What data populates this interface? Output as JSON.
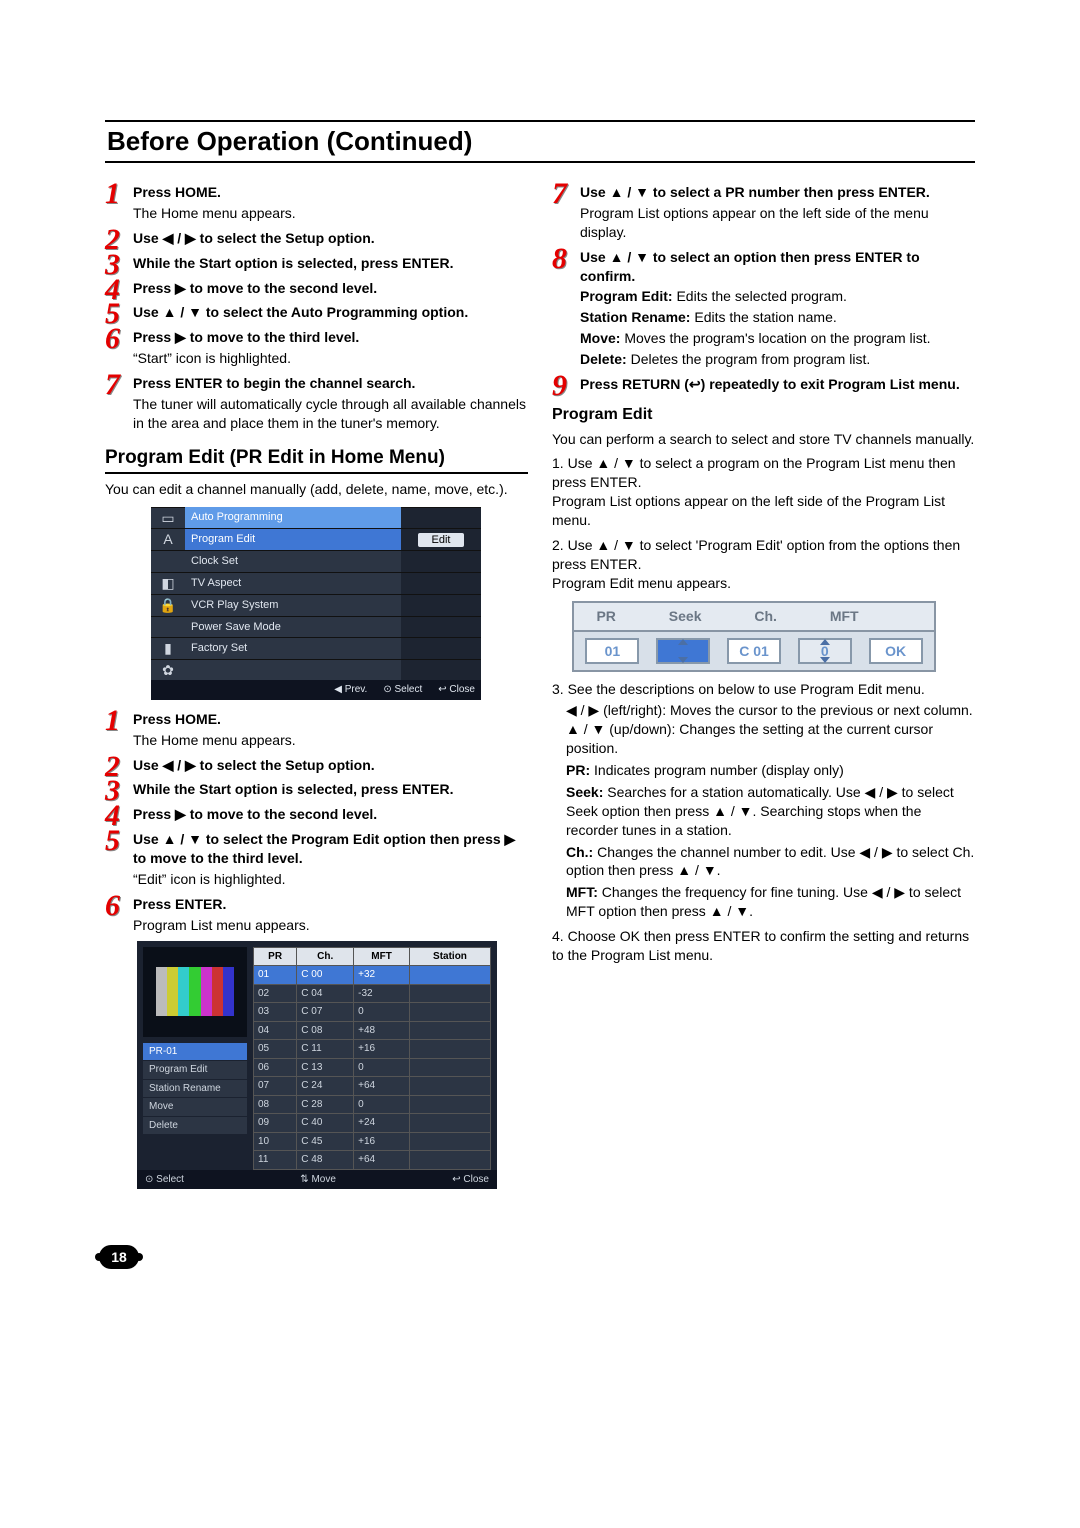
{
  "header": "Before Operation (Continued)",
  "left": {
    "stepsA": [
      {
        "n": "1",
        "title": "Press HOME.",
        "body": "The Home menu appears."
      },
      {
        "n": "2",
        "title": "Use ◀ / ▶ to select the Setup option."
      },
      {
        "n": "3",
        "title": "While the Start option is selected, press ENTER."
      },
      {
        "n": "4",
        "title": "Press ▶ to move to the second level."
      },
      {
        "n": "5",
        "title": "Use ▲ / ▼ to select the Auto Programming option."
      },
      {
        "n": "6",
        "title": "Press ▶ to move to the third level.",
        "body": "“Start” icon is highlighted."
      },
      {
        "n": "7",
        "title": "Press ENTER to begin the channel search.",
        "body": "The tuner will automatically cycle through all available channels in the area and place them in the tuner's memory."
      }
    ],
    "section1": "Program Edit (PR Edit in Home Menu)",
    "intro1": "You can edit a channel manually (add, delete, name, move, etc.).",
    "menu1": {
      "head": "Auto Programming",
      "items": [
        "Program Edit",
        "Clock Set",
        "TV Aspect",
        "VCR Play System",
        "Power Save Mode",
        "Factory Set"
      ],
      "editBtn": "Edit",
      "footer": [
        "◀ Prev.",
        "⊙ Select",
        "↩ Close"
      ]
    },
    "stepsB": [
      {
        "n": "1",
        "title": "Press HOME.",
        "body": "The Home menu appears."
      },
      {
        "n": "2",
        "title": "Use ◀ / ▶ to select the Setup option."
      },
      {
        "n": "3",
        "title": "While the Start option is selected, press ENTER."
      },
      {
        "n": "4",
        "title": "Press ▶ to move to the second level."
      },
      {
        "n": "5",
        "title": "Use ▲ / ▼ to select the Program Edit option then press ▶ to move to the third level.",
        "body": "“Edit” icon is highlighted."
      },
      {
        "n": "6",
        "title": "Press ENTER.",
        "body": "Program List menu appears."
      }
    ],
    "screen2": {
      "sideHead": "PR-01",
      "sideItems": [
        "Program Edit",
        "Station Rename",
        "Move",
        "Delete"
      ],
      "cols": [
        "PR",
        "Ch.",
        "MFT",
        "Station"
      ],
      "rows": [
        [
          "01",
          "C 00",
          "+32",
          ""
        ],
        [
          "02",
          "C 04",
          "-32",
          ""
        ],
        [
          "03",
          "C 07",
          "0",
          ""
        ],
        [
          "04",
          "C 08",
          "+48",
          ""
        ],
        [
          "05",
          "C 11",
          "+16",
          ""
        ],
        [
          "06",
          "C 13",
          "0",
          ""
        ],
        [
          "07",
          "C 24",
          "+64",
          ""
        ],
        [
          "08",
          "C 28",
          "0",
          ""
        ],
        [
          "09",
          "C 40",
          "+24",
          ""
        ],
        [
          "10",
          "C 45",
          "+16",
          ""
        ],
        [
          "11",
          "C 48",
          "+64",
          ""
        ]
      ],
      "footer": [
        "⊙ Select",
        "⇅ Move",
        "↩ Close"
      ]
    }
  },
  "right": {
    "stepsC": [
      {
        "n": "7",
        "title": "Use ▲ / ▼ to select a PR number then press ENTER.",
        "body": "Program List options appear on the left side of the menu display."
      },
      {
        "n": "8",
        "title": "Use ▲ / ▼ to select an option then press ENTER to confirm."
      }
    ],
    "optDefs": [
      {
        "b": "Program Edit:",
        "t": " Edits the selected program."
      },
      {
        "b": "Station Rename:",
        "t": " Edits the station name."
      },
      {
        "b": "Move:",
        "t": " Moves the program's location on the program list."
      },
      {
        "b": "Delete:",
        "t": " Deletes the program from program list."
      }
    ],
    "step9": {
      "n": "9",
      "title": "Press RETURN (↩) repeatedly to exit Program List menu."
    },
    "h3": "Program Edit",
    "p1": "You can perform a search to select and store TV channels manually.",
    "ol": [
      "Use ▲ / ▼ to select a program on the Program List menu then press ENTER.\nProgram List options appear on the left side of the Program List menu.",
      "Use ▲ / ▼ to select 'Program Edit' option from the options then press ENTER.\nProgram Edit menu appears.",
      "See the descriptions on below to use Program Edit menu.",
      "Choose OK then press ENTER to confirm the setting and returns to the Program List menu."
    ],
    "editbar": {
      "hdr": [
        "PR",
        "Seek",
        "Ch.",
        "MFT",
        ""
      ],
      "cells": [
        "01",
        "",
        "C 01",
        "0",
        "OK"
      ]
    },
    "bullets": [
      "◀ / ▶ (left/right): Moves the cursor to the previous or next column.",
      "▲ / ▼ (up/down): Changes the setting at the current cursor position."
    ],
    "defs": [
      {
        "b": "PR:",
        "t": " Indicates program number (display only)"
      },
      {
        "b": "Seek:",
        "t": " Searches for a station automatically. Use ◀ / ▶ to select Seek option then press ▲ / ▼. Searching stops when the recorder tunes in a station."
      },
      {
        "b": "Ch.:",
        "t": " Changes the channel number to edit. Use ◀ / ▶ to select Ch. option then press ▲ / ▼."
      },
      {
        "b": "MFT:",
        "t": " Changes the frequency for fine tuning. Use ◀ / ▶ to select MFT option then press ▲ / ▼."
      }
    ]
  },
  "pageNum": "18",
  "chart_data": {
    "type": "table",
    "title": "Program List",
    "columns": [
      "PR",
      "Ch.",
      "MFT",
      "Station"
    ],
    "rows": [
      [
        "01",
        "C 00",
        "+32",
        ""
      ],
      [
        "02",
        "C 04",
        "-32",
        ""
      ],
      [
        "03",
        "C 07",
        "0",
        ""
      ],
      [
        "04",
        "C 08",
        "+48",
        ""
      ],
      [
        "05",
        "C 11",
        "+16",
        ""
      ],
      [
        "06",
        "C 13",
        "0",
        ""
      ],
      [
        "07",
        "C 24",
        "+64",
        ""
      ],
      [
        "08",
        "C 28",
        "0",
        ""
      ],
      [
        "09",
        "C 40",
        "+24",
        ""
      ],
      [
        "10",
        "C 45",
        "+16",
        ""
      ],
      [
        "11",
        "C 48",
        "+64",
        ""
      ]
    ]
  }
}
